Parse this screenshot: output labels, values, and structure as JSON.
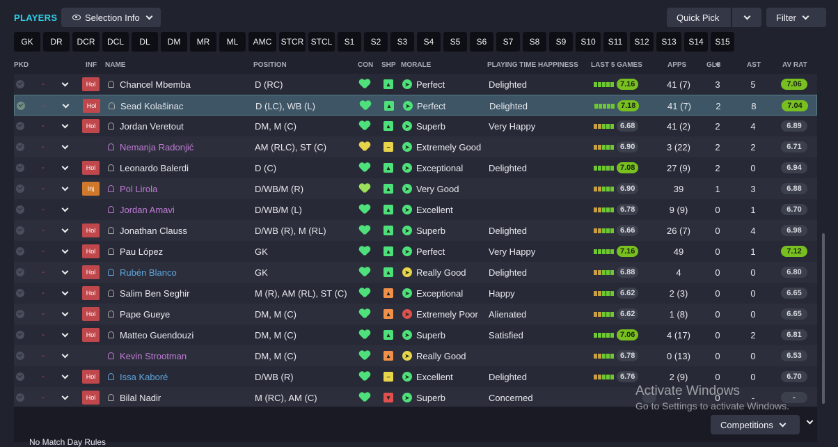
{
  "header": {
    "title": "PLAYERS",
    "selection_info": "Selection Info",
    "quick_pick": "Quick Pick",
    "filter": "Filter"
  },
  "position_filters": [
    "GK",
    "DR",
    "DCR",
    "DCL",
    "DL",
    "DM",
    "MR",
    "ML",
    "AMC",
    "STCR",
    "STCL",
    "S1",
    "S2",
    "S3",
    "S4",
    "S5",
    "S6",
    "S7",
    "S8",
    "S9",
    "S10",
    "S11",
    "S12",
    "S13",
    "S14",
    "S15"
  ],
  "columns": {
    "pkd": "PKD",
    "inf": "INF",
    "name": "NAME",
    "position": "POSITION",
    "con": "CON",
    "shp": "SHP",
    "morale": "MORALE",
    "pth": "PLAYING TIME HAPPINESS",
    "last5": "LAST 5 GAMES",
    "apps": "APPS",
    "gls": "GLS",
    "ast": "AST",
    "avrat": "AV RAT"
  },
  "colors": {
    "title": "#2fd0e8",
    "good": "#4ee07a",
    "rating_green": "#78c020",
    "injury": "#d0782c",
    "holiday": "#c0484c"
  },
  "rows": [
    {
      "name": "Chancel Mbemba",
      "inf": "Hol",
      "name_color": "white",
      "position": "D (RC)",
      "con": "green",
      "shp": "green",
      "morale_icon": "green",
      "morale": "Perfect",
      "pth": "Delighted",
      "last5": "7.16",
      "last5_hl": true,
      "apps": "41 (7)",
      "gls": "3",
      "ast": "5",
      "avrat": "7.06",
      "avrat_hl": true
    },
    {
      "name": "Sead Kolašinac",
      "inf": "Hol",
      "name_color": "white",
      "position": "D (LC), WB (L)",
      "con": "green",
      "shp": "green",
      "morale_icon": "green",
      "morale": "Perfect",
      "pth": "Delighted",
      "last5": "7.18",
      "last5_hl": true,
      "apps": "41 (7)",
      "gls": "2",
      "ast": "8",
      "avrat": "7.04",
      "avrat_hl": true,
      "selected": true
    },
    {
      "name": "Jordan Veretout",
      "inf": "Hol",
      "name_color": "white",
      "position": "DM, M (C)",
      "con": "green",
      "shp": "green",
      "morale_icon": "green",
      "morale": "Superb",
      "pth": "Very Happy",
      "last5": "6.68",
      "last5_hl": false,
      "apps": "41 (2)",
      "gls": "2",
      "ast": "4",
      "avrat": "6.89",
      "avrat_hl": false
    },
    {
      "name": "Nemanja Radonjić",
      "inf": "",
      "name_color": "purple",
      "position": "AM (RLC), ST (C)",
      "con": "yellow",
      "shp": "yellow",
      "morale_icon": "green",
      "morale": "Extremely Good",
      "pth": "",
      "last5": "6.90",
      "last5_hl": false,
      "apps": "3 (22)",
      "gls": "2",
      "ast": "2",
      "avrat": "6.71",
      "avrat_hl": false
    },
    {
      "name": "Leonardo Balerdi",
      "inf": "Hol",
      "name_color": "white",
      "position": "D (C)",
      "con": "green",
      "shp": "green",
      "morale_icon": "green",
      "morale": "Exceptional",
      "pth": "Delighted",
      "last5": "7.08",
      "last5_hl": true,
      "apps": "27 (9)",
      "gls": "2",
      "ast": "0",
      "avrat": "6.94",
      "avrat_hl": false
    },
    {
      "name": "Pol Lirola",
      "inf": "Inj",
      "name_color": "purple",
      "position": "D/WB/M (R)",
      "con": "lime",
      "shp": "green",
      "morale_icon": "green",
      "morale": "Very Good",
      "pth": "",
      "last5": "6.90",
      "last5_hl": false,
      "apps": "39",
      "gls": "1",
      "ast": "3",
      "avrat": "6.88",
      "avrat_hl": false
    },
    {
      "name": "Jordan Amavi",
      "inf": "",
      "name_color": "purple",
      "position": "D/WB/M (L)",
      "con": "green",
      "shp": "green",
      "morale_icon": "green",
      "morale": "Excellent",
      "pth": "",
      "last5": "6.78",
      "last5_hl": false,
      "apps": "9 (9)",
      "gls": "0",
      "ast": "1",
      "avrat": "6.70",
      "avrat_hl": false
    },
    {
      "name": "Jonathan Clauss",
      "inf": "Hol",
      "name_color": "white",
      "position": "D/WB (R), M (RL)",
      "con": "green",
      "shp": "green",
      "morale_icon": "green",
      "morale": "Superb",
      "pth": "Delighted",
      "last5": "6.66",
      "last5_hl": false,
      "apps": "26 (7)",
      "gls": "0",
      "ast": "4",
      "avrat": "6.98",
      "avrat_hl": false
    },
    {
      "name": "Pau López",
      "inf": "Hol",
      "name_color": "white",
      "position": "GK",
      "con": "green",
      "shp": "green",
      "morale_icon": "green",
      "morale": "Perfect",
      "pth": "Very Happy",
      "last5": "7.16",
      "last5_hl": true,
      "apps": "49",
      "gls": "0",
      "ast": "1",
      "avrat": "7.12",
      "avrat_hl": true
    },
    {
      "name": "Rubén Blanco",
      "inf": "Hol",
      "name_color": "blue",
      "position": "GK",
      "con": "green",
      "shp": "green",
      "morale_icon": "yellow",
      "morale": "Really Good",
      "pth": "Delighted",
      "last5": "6.88",
      "last5_hl": false,
      "apps": "4",
      "gls": "0",
      "ast": "0",
      "avrat": "6.80",
      "avrat_hl": false
    },
    {
      "name": "Salim Ben Seghir",
      "inf": "Hol",
      "name_color": "white",
      "position": "M (R), AM (RL), ST (C)",
      "con": "green",
      "shp": "orange",
      "morale_icon": "green",
      "morale": "Exceptional",
      "pth": "Happy",
      "last5": "6.62",
      "last5_hl": false,
      "apps": "2 (3)",
      "gls": "0",
      "ast": "0",
      "avrat": "6.65",
      "avrat_hl": false
    },
    {
      "name": "Pape Gueye",
      "inf": "Hol",
      "name_color": "white",
      "position": "DM, M (C)",
      "con": "green",
      "shp": "orange",
      "morale_icon": "red",
      "morale": "Extremely Poor",
      "pth": "Alienated",
      "last5": "6.62",
      "last5_hl": false,
      "apps": "1 (8)",
      "gls": "0",
      "ast": "0",
      "avrat": "6.65",
      "avrat_hl": false
    },
    {
      "name": "Matteo Guendouzi",
      "inf": "Hol",
      "name_color": "white",
      "position": "DM, M (C)",
      "con": "green",
      "shp": "green",
      "morale_icon": "green",
      "morale": "Superb",
      "pth": "Satisfied",
      "last5": "7.06",
      "last5_hl": true,
      "apps": "4 (17)",
      "gls": "0",
      "ast": "2",
      "avrat": "6.81",
      "avrat_hl": false
    },
    {
      "name": "Kevin Strootman",
      "inf": "",
      "name_color": "purple",
      "position": "DM, M (C)",
      "con": "green",
      "shp": "orange",
      "morale_icon": "yellow",
      "morale": "Really Good",
      "pth": "",
      "last5": "6.78",
      "last5_hl": false,
      "apps": "0 (13)",
      "gls": "0",
      "ast": "0",
      "avrat": "6.53",
      "avrat_hl": false
    },
    {
      "name": "Issa Kaboré",
      "inf": "Hol",
      "name_color": "blue",
      "position": "D/WB (R)",
      "con": "green",
      "shp": "yellow",
      "morale_icon": "green",
      "morale": "Excellent",
      "pth": "Delighted",
      "last5": "6.76",
      "last5_hl": false,
      "apps": "2 (9)",
      "gls": "0",
      "ast": "0",
      "avrat": "6.70",
      "avrat_hl": false
    },
    {
      "name": "Bilal Nadir",
      "inf": "Hol",
      "name_color": "white",
      "position": "M (RC), AM (C)",
      "con": "green",
      "shp": "red",
      "morale_icon": "green",
      "morale": "Superb",
      "pth": "Concerned",
      "last5": "",
      "last5_hl": false,
      "apps": "-",
      "gls": "0",
      "ast": "-",
      "avrat": "-",
      "avrat_hl": false
    }
  ],
  "footer": {
    "competitions": "Competitions",
    "no_match_day_rules": "No Match Day Rules"
  },
  "watermark": {
    "line1": "Activate Windows",
    "line2": "Go to Settings to activate Windows."
  }
}
